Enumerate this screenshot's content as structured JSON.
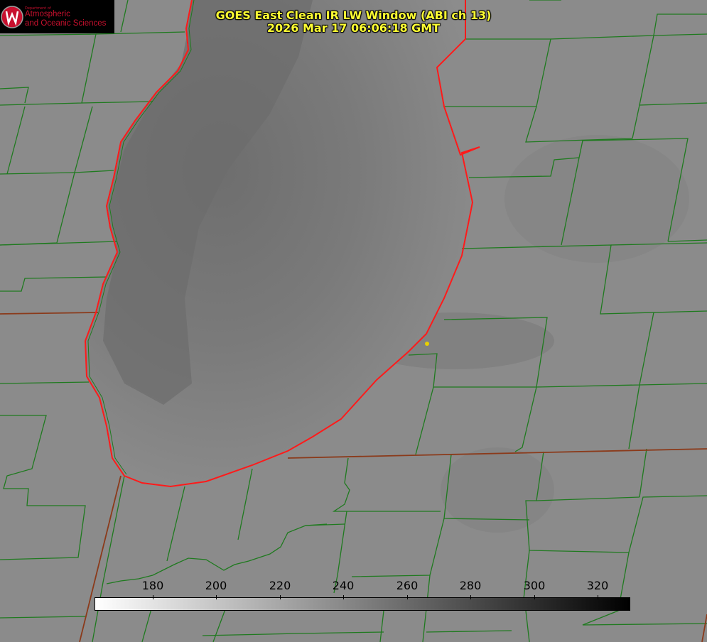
{
  "logo": {
    "department_line": "Department of",
    "line1": "Atmospheric",
    "line2": "and Oceanic Sciences"
  },
  "title": {
    "line1": "GOES East Clean IR LW Window (ABI ch 13)",
    "line2": "2026 Mar 17 06:06:18 GMT"
  },
  "colorbar": {
    "ticks": [
      "180",
      "200",
      "220",
      "240",
      "260",
      "280",
      "300",
      "320"
    ],
    "colors": {
      "low": "#ffffff",
      "high": "#000000"
    }
  },
  "colors": {
    "county_lines": "#1f7a1f",
    "state_lines": "#8b3a1a",
    "lake_shoreline": "#ff1a1a",
    "marker": "#e8d000",
    "title_text": "#ffff33"
  }
}
